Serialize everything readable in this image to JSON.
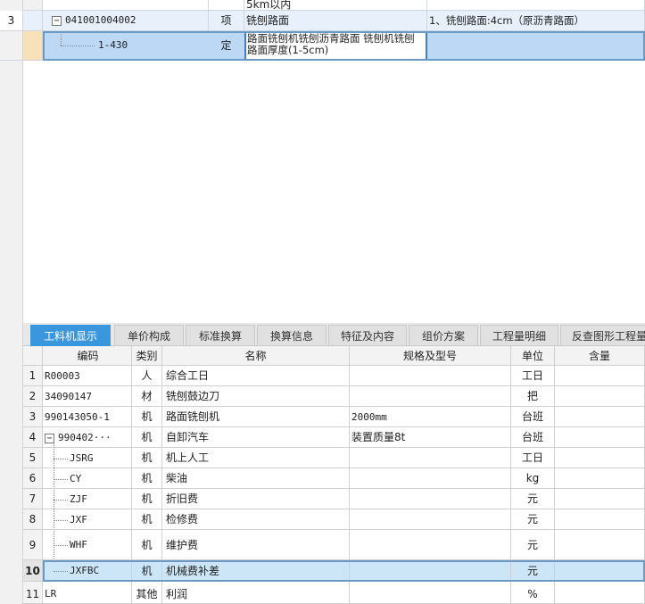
{
  "upper": {
    "partial_row": {
      "text": "5km以内"
    },
    "row3": {
      "num": "3",
      "code": "041001004002",
      "expand_symbol": "−",
      "type": "项",
      "name": "铣刨路面",
      "feature": "1、铣刨路面:4cm（原沥青路面）"
    },
    "row_sub": {
      "code": "1-430",
      "type": "定",
      "name_line1": "路面铣刨机铣刨沥青路面 铣刨机铣刨",
      "name_line2": "路面厚度(1-5cm)"
    }
  },
  "tabs": [
    {
      "label": "工料机显示",
      "active": true
    },
    {
      "label": "单价构成",
      "active": false
    },
    {
      "label": "标准换算",
      "active": false
    },
    {
      "label": "换算信息",
      "active": false
    },
    {
      "label": "特征及内容",
      "active": false
    },
    {
      "label": "组价方案",
      "active": false
    },
    {
      "label": "工程量明细",
      "active": false
    },
    {
      "label": "反查图形工程量",
      "active": false
    }
  ],
  "lower": {
    "headers": {
      "code": "编码",
      "type": "类别",
      "name": "名称",
      "spec": "规格及型号",
      "unit": "单位",
      "qty": "含量"
    },
    "rows": [
      {
        "num": "1",
        "code": "R00003",
        "type": "人",
        "name": "综合工日",
        "spec": "",
        "unit": "工日"
      },
      {
        "num": "2",
        "code": "34090147",
        "type": "材",
        "name": "铣刨鼓边刀",
        "spec": "",
        "unit": "把"
      },
      {
        "num": "3",
        "code": "990143050-1",
        "type": "机",
        "name": "路面铣刨机",
        "spec": "2000mm",
        "unit": "台班"
      },
      {
        "num": "4",
        "code": "990402···",
        "type": "机",
        "name": "自卸汽车",
        "spec": "装置质量8t",
        "unit": "台班",
        "expand_symbol": "−"
      },
      {
        "num": "5",
        "code": "JSRG",
        "type": "机",
        "name": "机上人工",
        "spec": "",
        "unit": "工日"
      },
      {
        "num": "6",
        "code": "CY",
        "type": "机",
        "name": "柴油",
        "spec": "",
        "unit": "kg"
      },
      {
        "num": "7",
        "code": "ZJF",
        "type": "机",
        "name": "折旧费",
        "spec": "",
        "unit": "元"
      },
      {
        "num": "8",
        "code": "JXF",
        "type": "机",
        "name": "检修费",
        "spec": "",
        "unit": "元"
      },
      {
        "num": "9",
        "code": "WHF",
        "type": "机",
        "name": "维护费",
        "spec": "",
        "unit": "元"
      },
      {
        "num": "10",
        "code": "JXFBC",
        "type": "机",
        "name": "机械费补差",
        "spec": "",
        "unit": "元"
      },
      {
        "num": "11",
        "code": "LR",
        "type": "其他",
        "name": "利润",
        "spec": "",
        "unit": "%"
      }
    ]
  },
  "colors": {
    "accent": "#3a96dd",
    "selected_row": "#cde6f7",
    "upper_selected": "#bcd8f5"
  }
}
